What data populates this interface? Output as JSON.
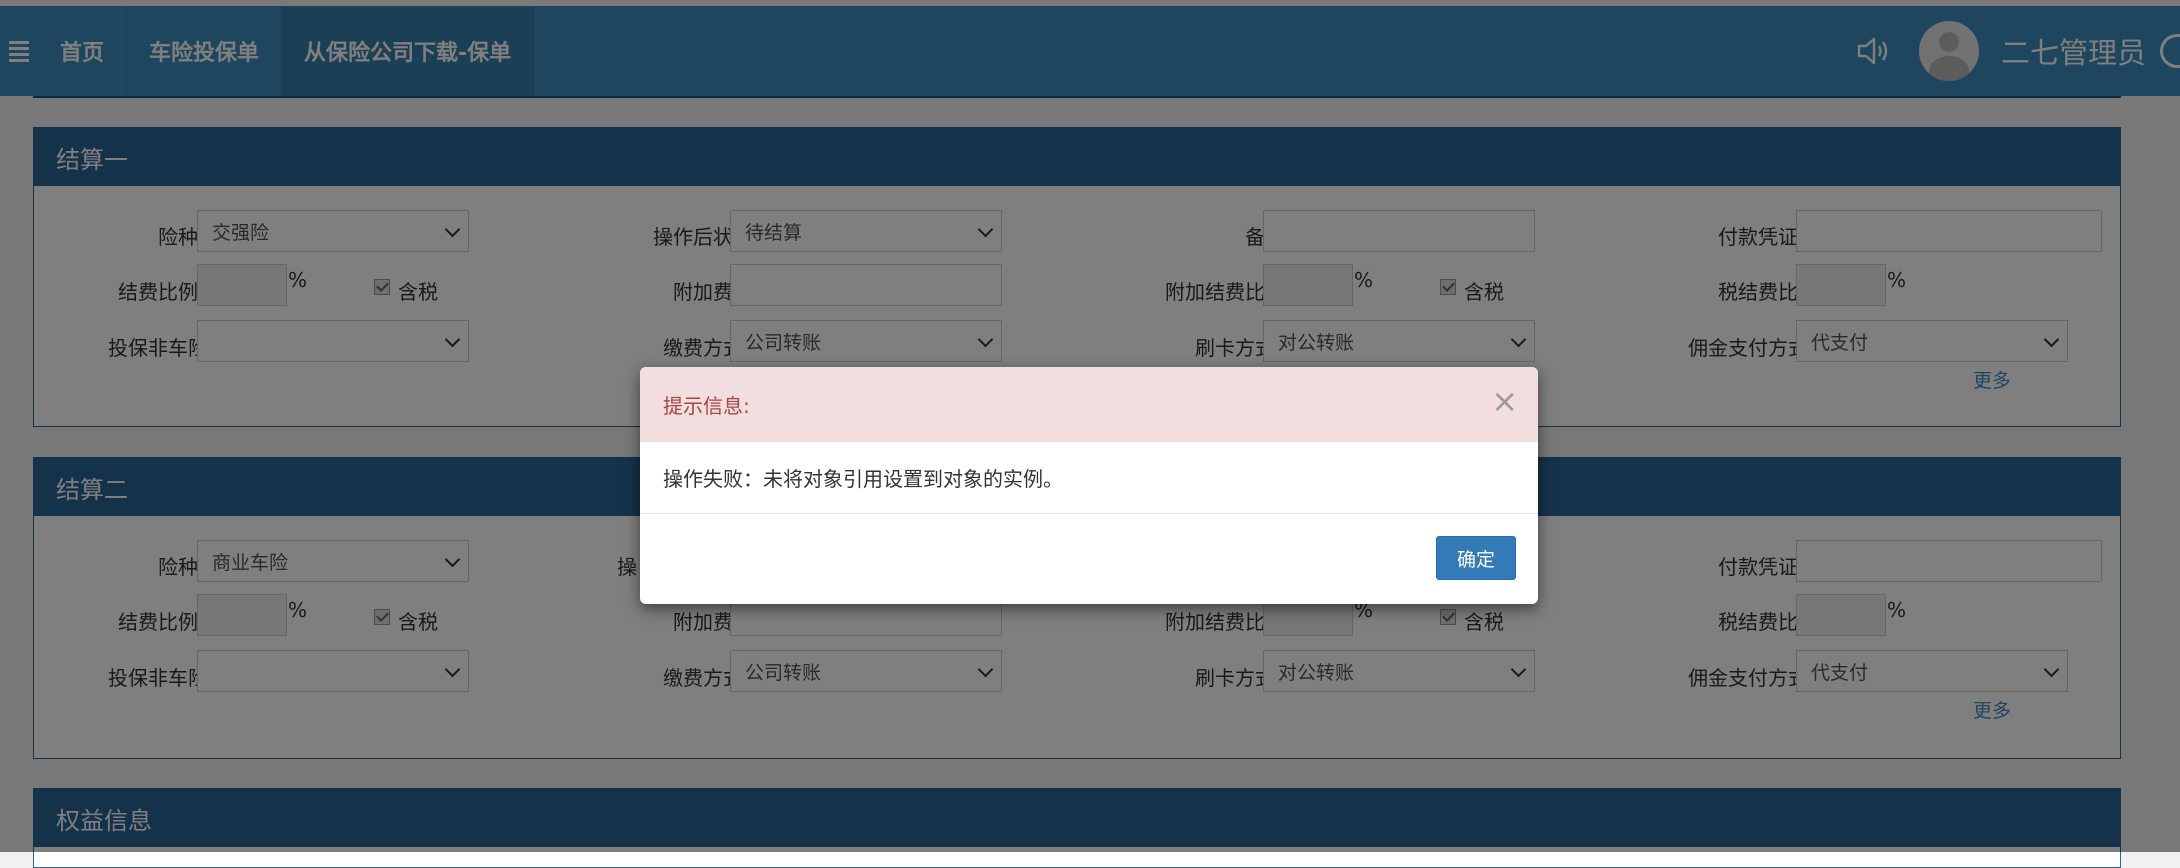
{
  "nav": {
    "tabs": [
      "首页",
      "车险投保单",
      "从保险公司下载-保单"
    ],
    "user": "二七管理员"
  },
  "panels": [
    {
      "title": "结算一",
      "row1": {
        "insurance_label": "险种",
        "insurance_value": "交强险",
        "after_status_label": "操作后状态",
        "after_status_value": "待结算",
        "remark_label": "备注",
        "voucher_label": "付款凭证号"
      },
      "row2": {
        "ratio_label": "结费比例",
        "pct": "%",
        "tax_label": "含税",
        "extra_fee_label": "附加费用",
        "extra_ratio_label": "附加结费比例",
        "tax_ratio_label": "税结费比例"
      },
      "row3": {
        "non_vehicle_label": "投保非车险",
        "non_vehicle_value": "",
        "pay_method_label": "缴费方式",
        "pay_method_value": "公司转账",
        "card_method_label": "刷卡方式",
        "card_method_value": "对公转账",
        "commission_label": "佣金支付方式",
        "commission_value": "代支付",
        "more": "更多"
      }
    },
    {
      "title": "结算二",
      "row1": {
        "insurance_label": "险种",
        "insurance_value": "商业车险",
        "after_status_label": "操",
        "voucher_label": "付款凭证号"
      },
      "row2": {
        "ratio_label": "结费比例",
        "pct": "%",
        "tax_label": "含税",
        "extra_fee_label": "附加费用",
        "extra_ratio_label": "附加结费比例",
        "tax_ratio_label": "税结费比例"
      },
      "row3": {
        "non_vehicle_label": "投保非车险",
        "non_vehicle_value": "",
        "pay_method_label": "缴费方式",
        "pay_method_value": "公司转账",
        "card_method_label": "刷卡方式",
        "card_method_value": "对公转账",
        "commission_label": "佣金支付方式",
        "commission_value": "代支付",
        "more": "更多"
      }
    },
    {
      "title": "权益信息"
    }
  ],
  "modal": {
    "title": "提示信息:",
    "close": "×",
    "message": "操作失败：未将对象引用设置到对象的实例。",
    "ok": "确定"
  }
}
